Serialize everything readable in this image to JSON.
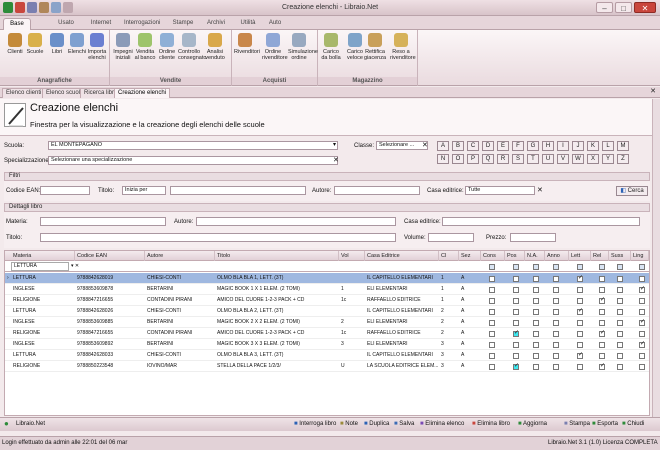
{
  "window": {
    "title": "Creazione elenchi - Libraio.Net"
  },
  "ribbon_tabs": [
    "Base",
    "Usato",
    "Internet",
    "Interrogazioni",
    "Stampe",
    "Archivi",
    "Utilità",
    "Auto"
  ],
  "groups": {
    "anagrafiche": "Anagrafiche",
    "vendite": "Vendite",
    "acquisti": "Acquisti",
    "magazzino": "Magazzino"
  },
  "ribbon_buttons": [
    {
      "label": "Clienti",
      "icon": "clients-icon",
      "color": "#c48a3a"
    },
    {
      "label": "Scuole",
      "icon": "school-icon",
      "color": "#d9b04a"
    },
    {
      "label": "Libri",
      "icon": "books-icon",
      "color": "#6a8fc9"
    },
    {
      "label": "Elenchi",
      "icon": "list-icon",
      "color": "#7fa0d0"
    },
    {
      "label": "Importa elenchi",
      "icon": "import-icon",
      "color": "#6b7fd1"
    },
    {
      "label": "Impegni iniziali",
      "icon": "commitments-icon",
      "color": "#8b9bb8"
    },
    {
      "label": "Vendita al banco",
      "icon": "counter-sale-icon",
      "color": "#9ec46b"
    },
    {
      "label": "Ordine cliente",
      "icon": "customer-order-icon",
      "color": "#8fb0d6"
    },
    {
      "label": "Controllo consegnato",
      "icon": "delivery-check-icon",
      "color": "#a7b7c9"
    },
    {
      "label": "Analisi venduto",
      "icon": "sales-analysis-icon",
      "color": "#d9a84a"
    },
    {
      "label": "Rivenditori",
      "icon": "dealers-icon",
      "color": "#c9874a"
    },
    {
      "label": "Ordine rivenditore",
      "icon": "dealer-order-icon",
      "color": "#8fa7d6"
    },
    {
      "label": "Simulazione ordine",
      "icon": "order-simulation-icon",
      "color": "#98a9c0"
    },
    {
      "label": "Carico da bolla",
      "icon": "load-delivery-icon",
      "color": "#a8b86b"
    },
    {
      "label": "Carico veloce",
      "icon": "quick-load-icon",
      "color": "#7fa4c9"
    },
    {
      "label": "Rettifica giacenza",
      "icon": "stock-adjust-icon",
      "color": "#c9a05a"
    },
    {
      "label": "Reso a rivenditore",
      "icon": "return-icon",
      "color": "#d6b25a"
    }
  ],
  "doc_tabs": [
    "Elenco clienti",
    "Elenco scuole",
    "Ricerca libri",
    "Creazione elenchi"
  ],
  "header": {
    "title": "Creazione elenchi",
    "subtitle": "Finestra per la visualizzazione e la creazione degli elenchi delle scuole"
  },
  "form": {
    "scuola_label": "Scuola:",
    "scuola_value": "EL MONTEPAGANO",
    "classe_label": "Classe:",
    "classe_value": "Selezionare ...",
    "spec_label": "Specializzazione:",
    "spec_value": "Selezionare una specializzazione"
  },
  "letters": [
    "A",
    "B",
    "C",
    "D",
    "E",
    "F",
    "G",
    "H",
    "I",
    "J",
    "K",
    "L",
    "M",
    "N",
    "O",
    "P",
    "Q",
    "R",
    "S",
    "T",
    "U",
    "V",
    "W",
    "X",
    "Y",
    "Z"
  ],
  "filters": {
    "title": "Filtri",
    "ean_label": "Codice EAN:",
    "titolo_label": "Titolo:",
    "titolo_mode": "Inizia per",
    "autore_label": "Autore:",
    "casa_label": "Casa editrice:",
    "casa_value": "Tutte",
    "search_label": "Cerca"
  },
  "details": {
    "title": "Dettagli libro",
    "materia": "Materia:",
    "autore": "Autore:",
    "casa": "Casa editrice:",
    "titolo": "Titolo:",
    "volume": "Volume:",
    "prezzo": "Prezzo:"
  },
  "columns": [
    "Materia",
    "Codice EAN",
    "Autore",
    "Titolo",
    "Vol",
    "Casa Editrice",
    "Cl",
    "Sez",
    "Cons",
    "Pos",
    "N.A.",
    "Anno",
    "Lett",
    "Rel",
    "Suss",
    "Ling"
  ],
  "filter_row": {
    "materia": "LETTURA"
  },
  "rows": [
    {
      "materia": "LETTURA",
      "ean": "9788842628019",
      "autore": "CHIESI-CONTI",
      "titolo": "OLMO BLA BLA 1, LETT. (3T)",
      "vol": "",
      "casa": "IL CAPITELLO ELEMENTARI",
      "cl": "1",
      "sez": "A",
      "checks": [
        0,
        0,
        0,
        0,
        1,
        0,
        0,
        0
      ],
      "hl": -1,
      "sel": true
    },
    {
      "materia": "INGLESE",
      "ean": "9788853609878",
      "autore": "BERTARINI",
      "titolo": "MAGIC BOOK 1 X 1 ELEM. (2 TOMI)",
      "vol": "1",
      "casa": "ELI ELEMENTARI",
      "cl": "1",
      "sez": "A",
      "checks": [
        0,
        0,
        0,
        0,
        0,
        0,
        0,
        1
      ],
      "hl": -1,
      "sel": false
    },
    {
      "materia": "RELIGIONE",
      "ean": "9788847216655",
      "autore": "CONTADINI PIRANI",
      "titolo": "AMICO DEL CUORE 1-2-3 PACK + CD",
      "vol": "1c",
      "casa": "RAFFAELLO EDITRICE",
      "cl": "1",
      "sez": "A",
      "checks": [
        0,
        0,
        0,
        0,
        0,
        1,
        0,
        0
      ],
      "hl": -1,
      "sel": false
    },
    {
      "materia": "LETTURA",
      "ean": "9788842628026",
      "autore": "CHIESI-CONTI",
      "titolo": "OLMO BLA BLA 2, LETT. (3T)",
      "vol": "",
      "casa": "IL CAPITELLO ELEMENTARI",
      "cl": "2",
      "sez": "A",
      "checks": [
        0,
        0,
        0,
        0,
        1,
        0,
        0,
        0
      ],
      "hl": -1,
      "sel": false
    },
    {
      "materia": "INGLESE",
      "ean": "9788853609885",
      "autore": "BERTARINI",
      "titolo": "MAGIC BOOK 2 X 2 ELEM. (2 TOMI)",
      "vol": "2",
      "casa": "ELI ELEMENTARI",
      "cl": "2",
      "sez": "A",
      "checks": [
        0,
        0,
        0,
        0,
        0,
        0,
        0,
        1
      ],
      "hl": -1,
      "sel": false
    },
    {
      "materia": "RELIGIONE",
      "ean": "9788847216655",
      "autore": "CONTADINI PIRANI",
      "titolo": "AMICO DEL CUORE 1-2-3 PACK + CD",
      "vol": "1c",
      "casa": "RAFFAELLO EDITRICE",
      "cl": "2",
      "sez": "A",
      "checks": [
        0,
        1,
        0,
        0,
        0,
        1,
        0,
        0
      ],
      "hl": 1,
      "sel": false
    },
    {
      "materia": "INGLESE",
      "ean": "9788853609892",
      "autore": "BERTARINI",
      "titolo": "MAGIC BOOK 3 X 3 ELEM. (2 TOMI)",
      "vol": "3",
      "casa": "ELI ELEMENTARI",
      "cl": "3",
      "sez": "A",
      "checks": [
        0,
        0,
        0,
        0,
        0,
        0,
        0,
        1
      ],
      "hl": -1,
      "sel": false
    },
    {
      "materia": "LETTURA",
      "ean": "9788842628033",
      "autore": "CHIESI-CONTI",
      "titolo": "OLMO BLA BLA 3, LETT. (3T)",
      "vol": "",
      "casa": "IL CAPITELLO ELEMENTARI",
      "cl": "3",
      "sez": "A",
      "checks": [
        0,
        0,
        0,
        0,
        1,
        0,
        0,
        0
      ],
      "hl": -1,
      "sel": false
    },
    {
      "materia": "RELIGIONE",
      "ean": "9788850223548",
      "autore": "IOVINO/MAR",
      "titolo": "STELLA DELLA PACE 1/2/3/",
      "vol": "U",
      "casa": "LA SCUOLA EDITRICE ELEM...",
      "cl": "3",
      "sez": "A",
      "checks": [
        0,
        1,
        0,
        0,
        0,
        1,
        0,
        0
      ],
      "hl": 1,
      "sel": false
    }
  ],
  "statusbar": {
    "app": "Libraio.Net",
    "actions": [
      "Interroga libro",
      "Note",
      "Duplica",
      "Salva",
      "Elimina elenco",
      "Elimina libro",
      "Aggiorna",
      "Stampa",
      "Esporta",
      "Chiudi"
    ]
  },
  "footer": {
    "login": "Login effettuato da admin alle 22:01 del 06 mar",
    "version": "Libraio.Net 3.1 (1.0) Licenza COMPLETA"
  }
}
